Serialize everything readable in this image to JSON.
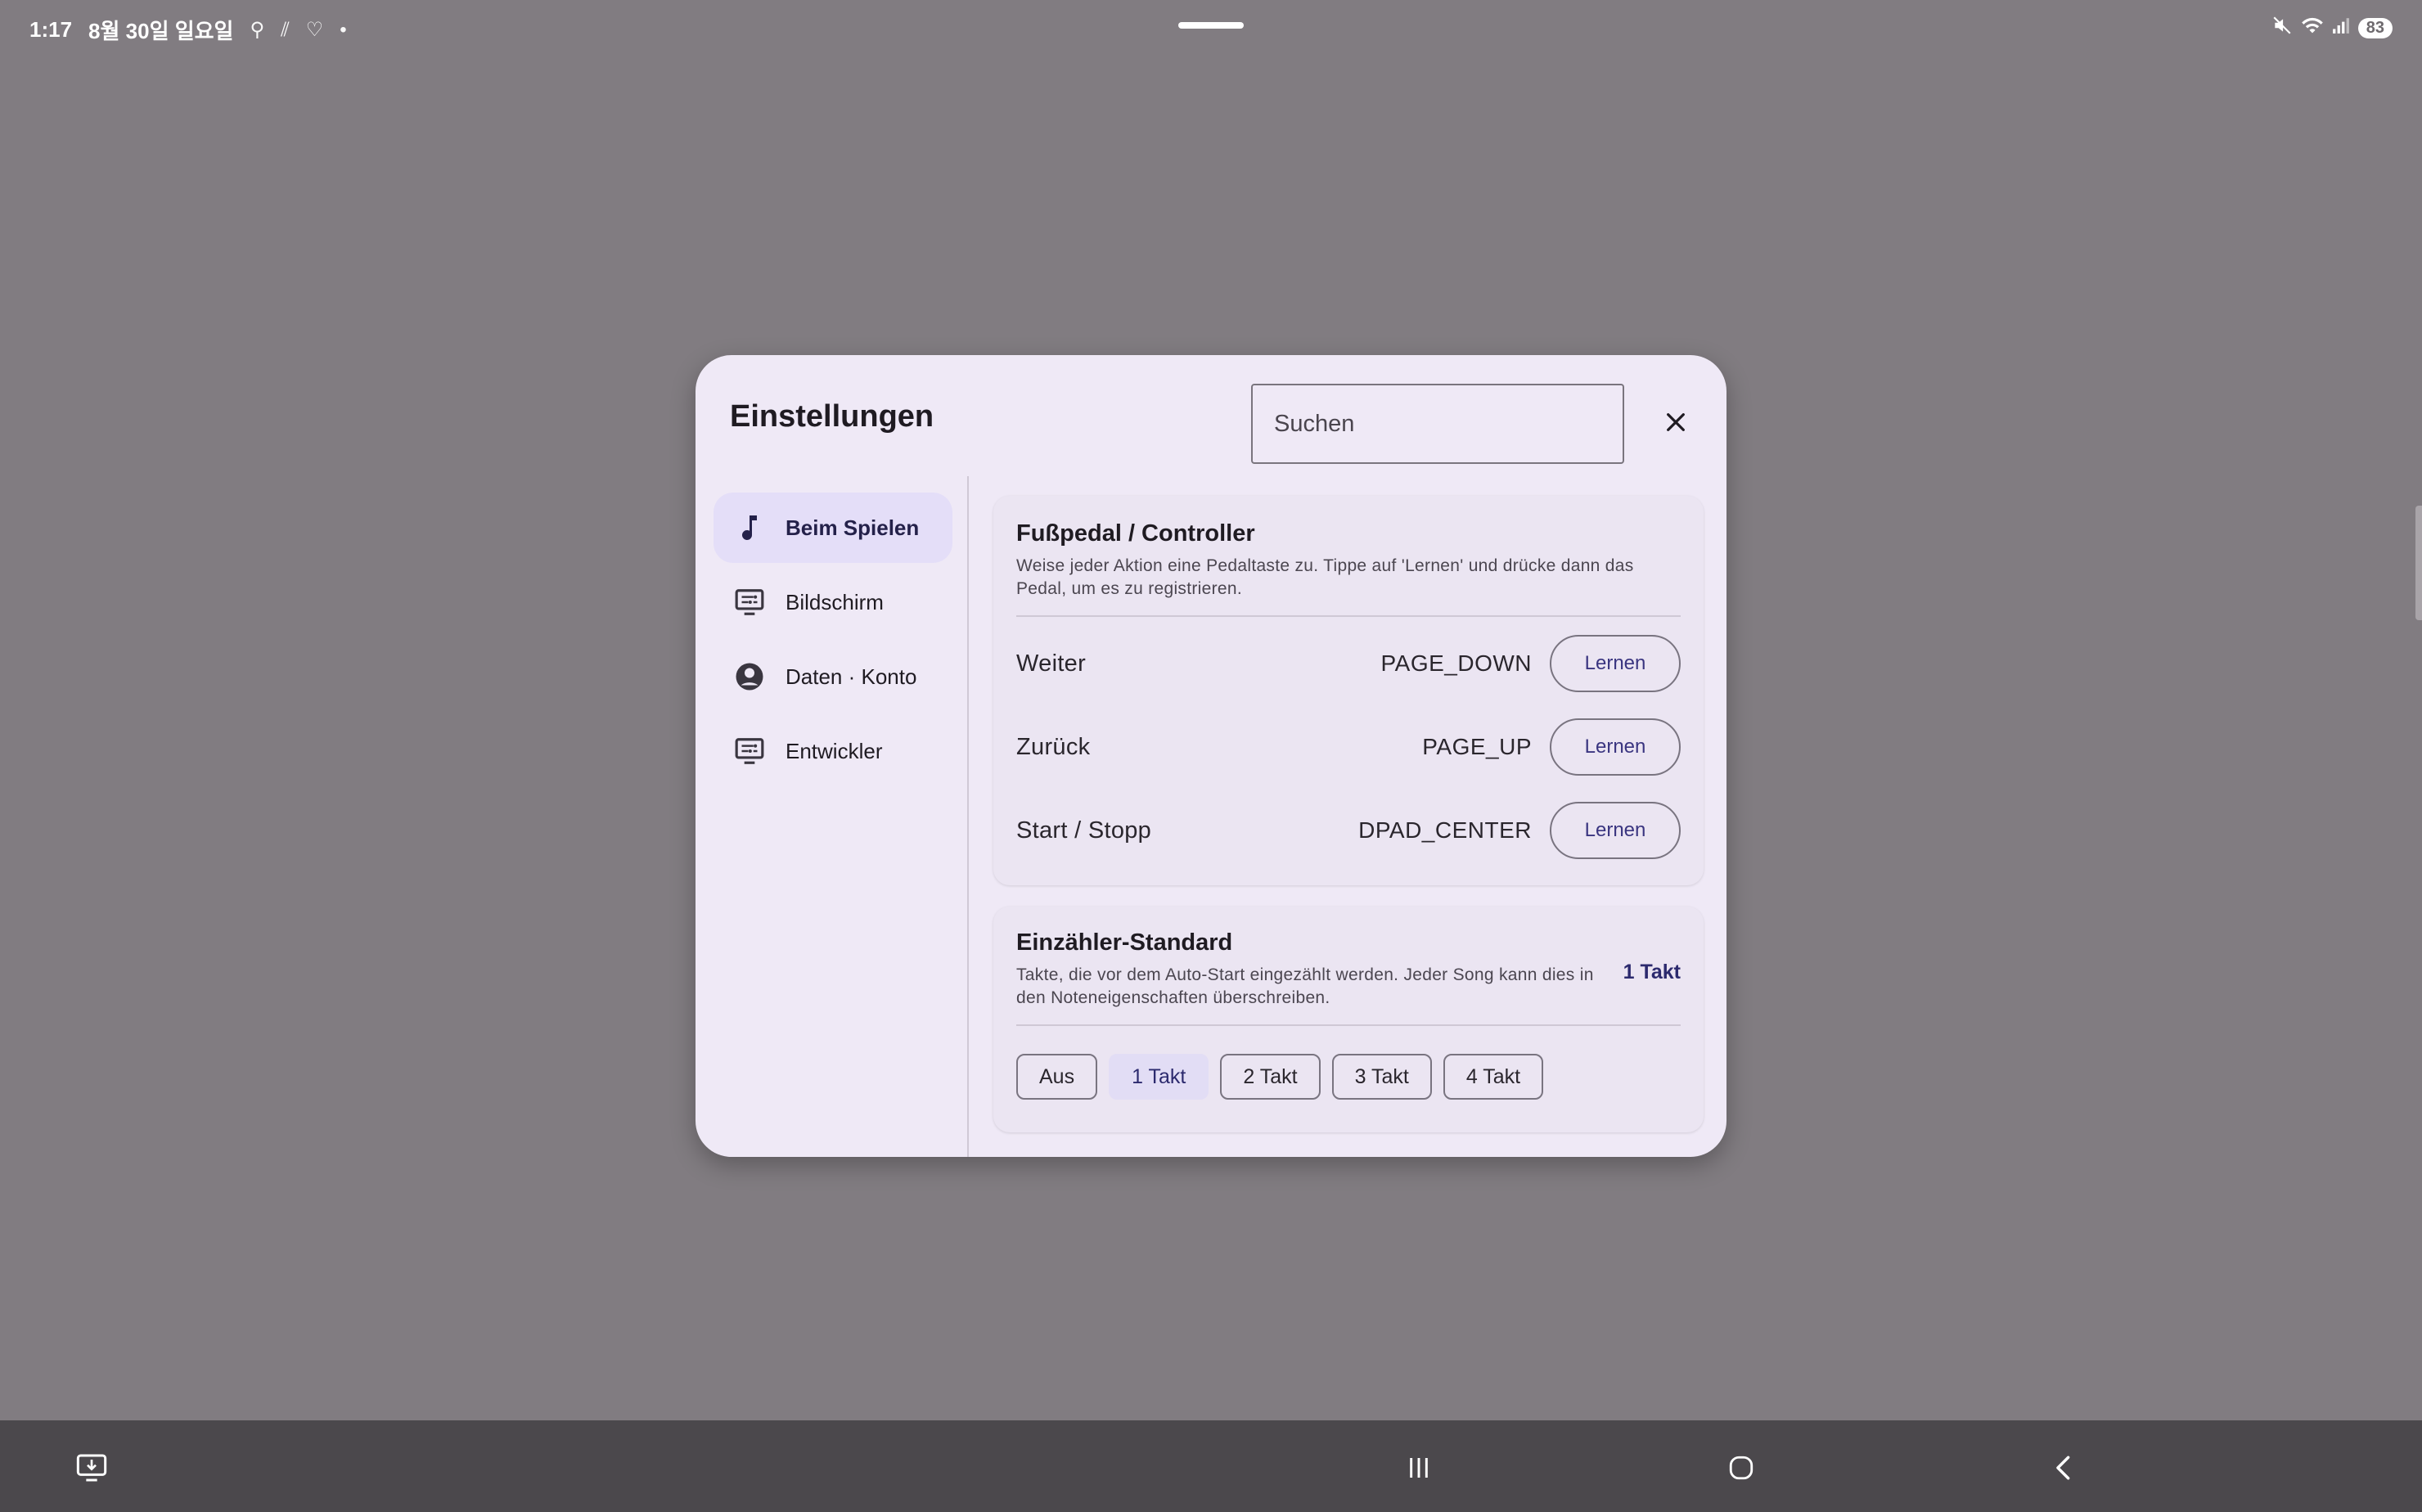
{
  "status_bar": {
    "time": "1:17",
    "date": "8월 30일 일요일",
    "battery": "83"
  },
  "dialog": {
    "title": "Einstellungen",
    "search_placeholder": "Suchen"
  },
  "sidebar": {
    "items": [
      {
        "label": "Beim Spielen",
        "icon": "music-note-icon",
        "active": true
      },
      {
        "label": "Bildschirm",
        "icon": "display-settings-icon",
        "active": false
      },
      {
        "label": "Daten · Konto",
        "icon": "account-circle-icon",
        "active": false
      },
      {
        "label": "Entwickler",
        "icon": "display-settings-icon",
        "active": false
      }
    ]
  },
  "pedal_card": {
    "title": "Fußpedal / Controller",
    "description": "Weise jeder Aktion eine Pedaltaste zu. Tippe auf 'Lernen' und drücke dann das Pedal, um es zu registrieren.",
    "rows": [
      {
        "label": "Weiter",
        "key": "PAGE_DOWN",
        "button": "Lernen"
      },
      {
        "label": "Zurück",
        "key": "PAGE_UP",
        "button": "Lernen"
      },
      {
        "label": "Start / Stopp",
        "key": "DPAD_CENTER",
        "button": "Lernen"
      }
    ]
  },
  "countin_card": {
    "title": "Einzähler-Standard",
    "description": "Takte, die vor dem Auto-Start eingezählt werden. Jeder Song kann dies in den Noteneigenschaften überschreiben.",
    "current_value": "1 Takt",
    "options": [
      "Aus",
      "1 Takt",
      "2 Takt",
      "3 Takt",
      "4 Takt"
    ],
    "selected_index": 1
  },
  "colors": {
    "backdrop": "#817c81",
    "surface": "#efe9f6",
    "accent": "#2c2a6e",
    "selected_bg": "#e4def8"
  }
}
